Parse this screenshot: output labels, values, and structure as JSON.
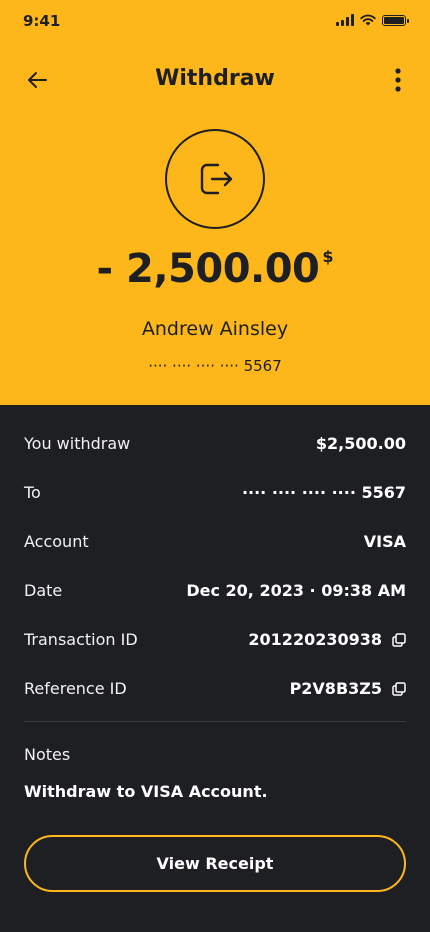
{
  "status_bar": {
    "time": "9:41"
  },
  "header": {
    "title": "Withdraw"
  },
  "summary": {
    "amount": "- 2,500.00",
    "currency": "$",
    "name": "Andrew Ainsley",
    "masked_account": "···· ···· ···· ···· 5567"
  },
  "details": [
    {
      "label": "You withdraw",
      "value": "$2,500.00"
    },
    {
      "label": "To",
      "value": "···· ···· ···· ···· 5567"
    },
    {
      "label": "Account",
      "value": "VISA"
    },
    {
      "label": "Date",
      "value": "Dec 20, 2023 · 09:38 AM"
    },
    {
      "label": "Transaction ID",
      "value": "201220230938"
    },
    {
      "label": "Reference ID",
      "value": "P2V8B3Z5"
    }
  ],
  "notes": {
    "label": "Notes",
    "text": "Withdraw to VISA Account."
  },
  "action": {
    "label": "View Receipt"
  },
  "colors": {
    "accent": "#fdb71a",
    "background": "#1e1f23"
  }
}
